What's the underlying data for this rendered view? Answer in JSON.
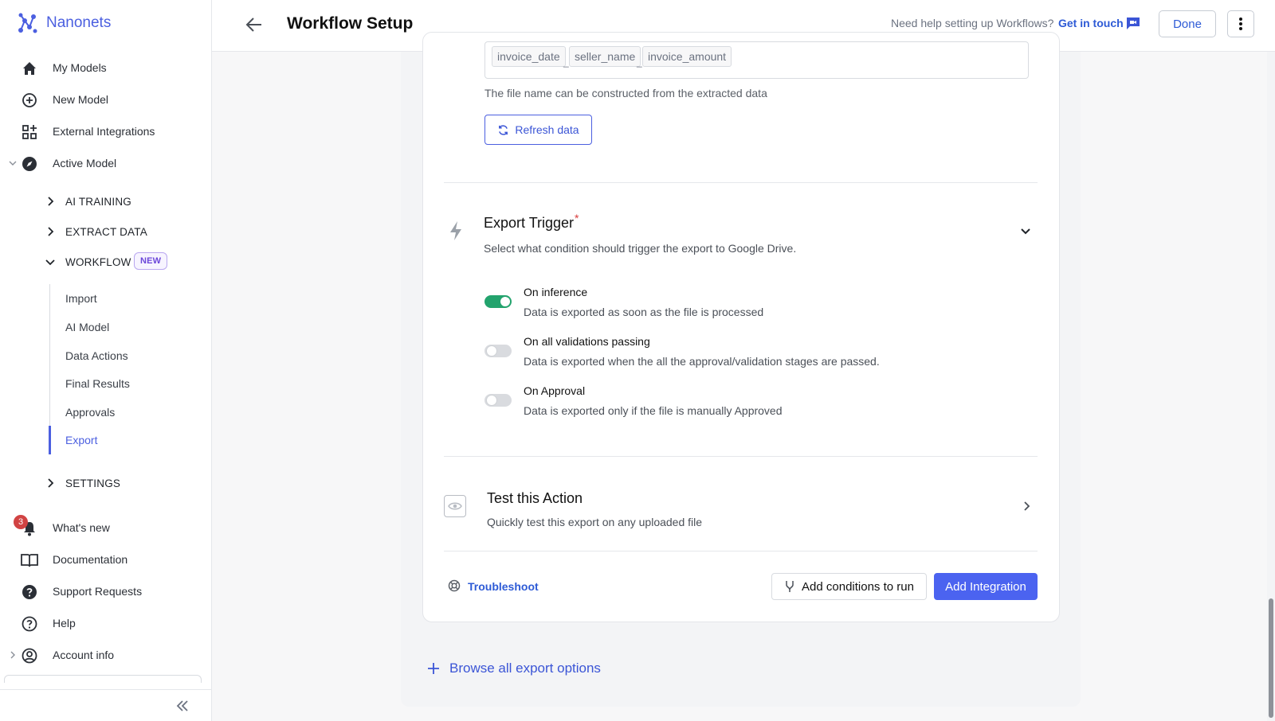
{
  "brand": {
    "name": "Nanonets"
  },
  "sidebar": {
    "top_items": [
      {
        "label": "My Models",
        "icon": "home-icon"
      },
      {
        "label": "New Model",
        "icon": "plus-circle-icon"
      },
      {
        "label": "External Integrations",
        "icon": "grid-plus-icon"
      },
      {
        "label": "Active Model",
        "icon": "compass-icon"
      }
    ],
    "sections": [
      {
        "label": "AI TRAINING"
      },
      {
        "label": "EXTRACT DATA"
      },
      {
        "label": "WORKFLOW",
        "badge": "NEW"
      },
      {
        "label": "SETTINGS"
      }
    ],
    "workflow_items": [
      "Import",
      "AI Model",
      "Data Actions",
      "Final Results",
      "Approvals",
      "Export"
    ],
    "active_workflow_item": "Export",
    "bottom_items": [
      {
        "label": "What's new",
        "icon": "bell-icon",
        "badge": "3"
      },
      {
        "label": "Documentation",
        "icon": "book-icon"
      },
      {
        "label": "Support Requests",
        "icon": "question-filled-icon"
      },
      {
        "label": "Help",
        "icon": "question-circle-icon"
      },
      {
        "label": "Account info",
        "icon": "user-circle-icon"
      }
    ]
  },
  "header": {
    "title": "Workflow Setup",
    "help_text": "Need help setting up Workflows?",
    "help_link": "Get in touch",
    "done_label": "Done"
  },
  "filename": {
    "chips": [
      "invoice_date",
      "seller_name",
      "invoice_amount"
    ],
    "separator": "_",
    "hint": "The file name can be constructed from the extracted data",
    "refresh_label": "Refresh data"
  },
  "export_trigger": {
    "title": "Export Trigger",
    "required_mark": "*",
    "subtitle": "Select what condition should trigger the export to Google Drive.",
    "options": [
      {
        "title": "On inference",
        "desc": "Data is exported as soon as the file is processed",
        "enabled": true
      },
      {
        "title": "On all validations passing",
        "desc": "Data is exported when the all the approval/validation stages are passed.",
        "enabled": false
      },
      {
        "title": "On Approval",
        "desc": "Data is exported only if the file is manually Approved",
        "enabled": false
      }
    ]
  },
  "test_action": {
    "title": "Test this Action",
    "subtitle": "Quickly test this export on any uploaded file"
  },
  "footer": {
    "troubleshoot": "Troubleshoot",
    "conditions_label": "Add conditions to run",
    "add_integration_label": "Add Integration"
  },
  "browse_label": "Browse all export options",
  "colors": {
    "accent": "#4b5fe0",
    "toggle_on": "#23a36d",
    "badge_new": "#6b46d9",
    "notification": "#d14343"
  }
}
